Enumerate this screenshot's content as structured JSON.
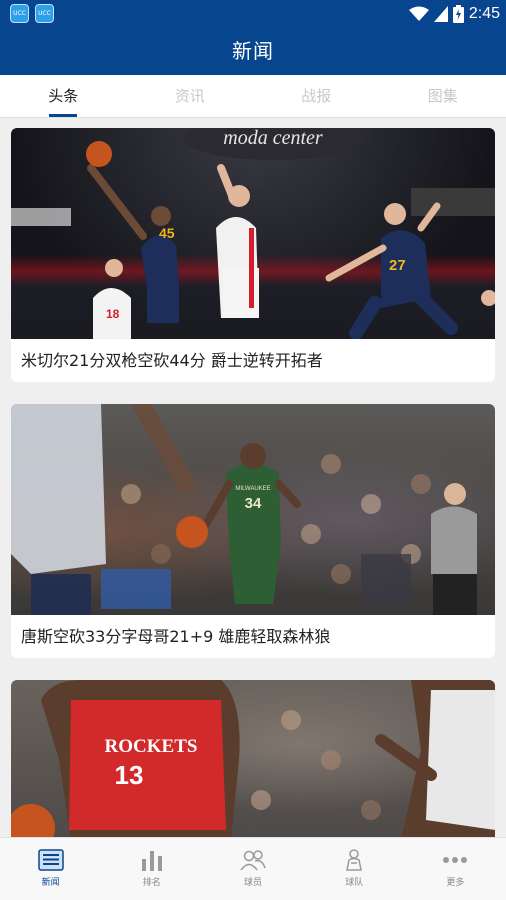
{
  "status_bar": {
    "app_icon_text": "UCC",
    "time": "2:45"
  },
  "header": {
    "title": "新闻"
  },
  "tabs": [
    {
      "label": "头条",
      "active": true
    },
    {
      "label": "资讯",
      "active": false
    },
    {
      "label": "战报",
      "active": false
    },
    {
      "label": "图集",
      "active": false
    }
  ],
  "news": [
    {
      "title": "米切尔21分双枪空砍44分 爵士逆转开拓者",
      "banner_text": "moda center",
      "jersey_numbers": [
        "45",
        "27",
        "18"
      ]
    },
    {
      "title": "唐斯空砍33分字母哥21+9 雄鹿轻取森林狼",
      "jersey_text": "MILWAUKEE",
      "jersey_number": "34"
    },
    {
      "jersey_text": "ROCKETS",
      "jersey_number": "13"
    }
  ],
  "bottom_nav": [
    {
      "label": "新闻",
      "icon": "news-icon",
      "active": true
    },
    {
      "label": "排名",
      "icon": "ranking-icon",
      "active": false
    },
    {
      "label": "球员",
      "icon": "players-icon",
      "active": false
    },
    {
      "label": "球队",
      "icon": "team-icon",
      "active": false
    },
    {
      "label": "更多",
      "icon": "more-icon",
      "active": false
    }
  ],
  "colors": {
    "primary": "#08458f",
    "background": "#efefef",
    "tab_inactive": "#c9c9c9",
    "jazz_navy": "#1d2e5a",
    "jazz_gold": "#f2b51e",
    "blazers_red": "#d11f2e",
    "bucks_green": "#2d5e34",
    "rockets_red": "#d22a2a"
  }
}
